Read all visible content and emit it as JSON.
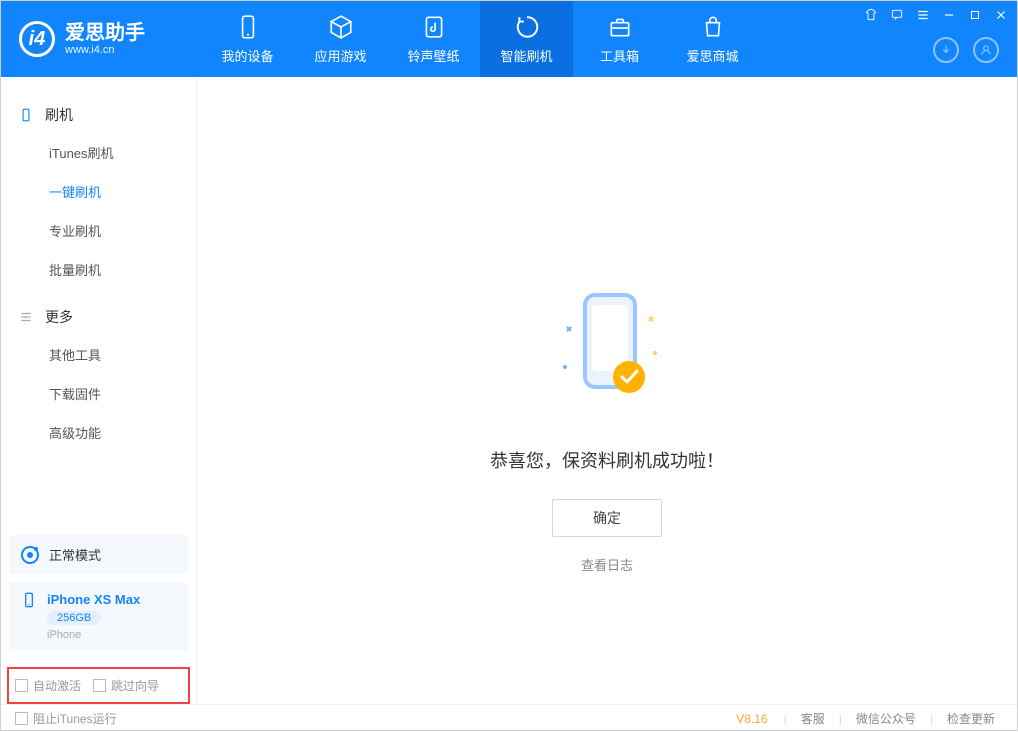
{
  "app": {
    "title": "爱思助手",
    "subtitle": "www.i4.cn"
  },
  "nav": {
    "tabs": [
      {
        "label": "我的设备"
      },
      {
        "label": "应用游戏"
      },
      {
        "label": "铃声壁纸"
      },
      {
        "label": "智能刷机"
      },
      {
        "label": "工具箱"
      },
      {
        "label": "爱思商城"
      }
    ]
  },
  "sidebar": {
    "group1": {
      "label": "刷机"
    },
    "items1": [
      {
        "label": "iTunes刷机"
      },
      {
        "label": "一键刷机"
      },
      {
        "label": "专业刷机"
      },
      {
        "label": "批量刷机"
      }
    ],
    "group2": {
      "label": "更多"
    },
    "items2": [
      {
        "label": "其他工具"
      },
      {
        "label": "下载固件"
      },
      {
        "label": "高级功能"
      }
    ],
    "mode": {
      "label": "正常模式"
    },
    "device": {
      "name": "iPhone XS Max",
      "storage": "256GB",
      "type": "iPhone"
    },
    "checkboxes": {
      "auto_activate": "自动激活",
      "skip_guide": "跳过向导"
    }
  },
  "main": {
    "success_text": "恭喜您，保资料刷机成功啦！",
    "ok_button": "确定",
    "log_link": "查看日志"
  },
  "footer": {
    "block_itunes": "阻止iTunes运行",
    "version": "V8.16",
    "links": {
      "service": "客服",
      "wechat": "微信公众号",
      "update": "检查更新"
    }
  }
}
